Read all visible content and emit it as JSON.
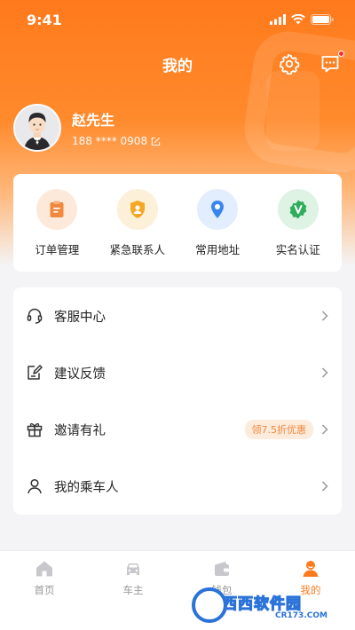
{
  "status_bar": {
    "time": "9:41"
  },
  "nav": {
    "title": "我的"
  },
  "profile": {
    "name": "赵先生",
    "phone": "188 **** 0908"
  },
  "quick_actions": [
    {
      "label": "订单管理",
      "icon": "clipboard-icon",
      "color": "#f0883e"
    },
    {
      "label": "紧急联系人",
      "icon": "shield-person-icon",
      "color": "#f5a623"
    },
    {
      "label": "常用地址",
      "icon": "location-pin-icon",
      "color": "#3a86f0"
    },
    {
      "label": "实名认证",
      "icon": "verified-v-icon",
      "color": "#2fae5a"
    }
  ],
  "menu": [
    {
      "label": "客服中心",
      "icon": "headset-icon"
    },
    {
      "label": "建议反馈",
      "icon": "feedback-icon"
    },
    {
      "label": "邀请有礼",
      "icon": "gift-icon",
      "badge": "领7.5折优惠"
    },
    {
      "label": "我的乘车人",
      "icon": "person-icon"
    }
  ],
  "tabs": [
    {
      "label": "首页",
      "icon": "home-icon"
    },
    {
      "label": "车主",
      "icon": "car-icon"
    },
    {
      "label": "钱包",
      "icon": "wallet-icon"
    },
    {
      "label": "我的",
      "icon": "user-icon",
      "active": true
    }
  ],
  "watermark": {
    "main": "西西软件园",
    "sub": "CR173.COM"
  },
  "colors": {
    "accent": "#ff7a1c",
    "badge_bg": "#fdebdc",
    "badge_text": "#f08a3e"
  }
}
